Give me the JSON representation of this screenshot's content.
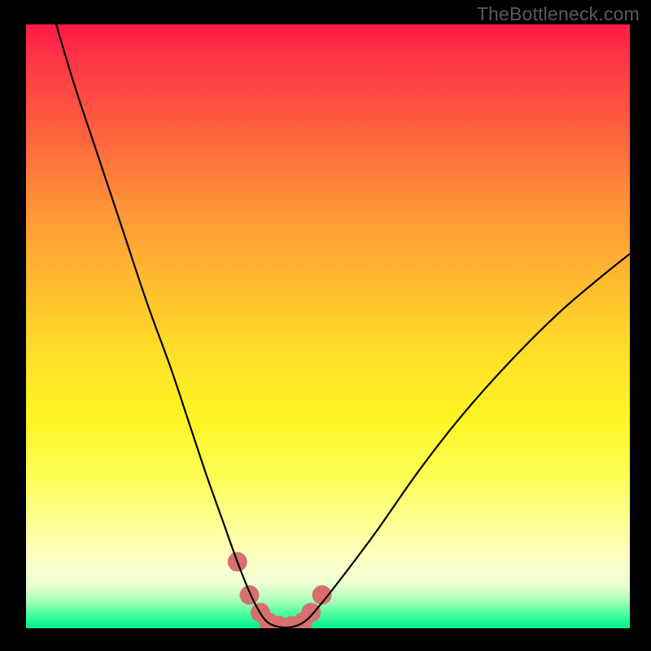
{
  "watermark": "TheBottleneck.com",
  "chart_data": {
    "type": "line",
    "title": "",
    "xlabel": "",
    "ylabel": "",
    "xlim": [
      0,
      100
    ],
    "ylim": [
      0,
      100
    ],
    "background_gradient": {
      "stops": [
        {
          "pos": 0.0,
          "color": "#ff1b48"
        },
        {
          "pos": 0.05,
          "color": "#ff3246"
        },
        {
          "pos": 0.2,
          "color": "#ff6a3d"
        },
        {
          "pos": 0.32,
          "color": "#ff9a36"
        },
        {
          "pos": 0.45,
          "color": "#ffc22e"
        },
        {
          "pos": 0.55,
          "color": "#ffe028"
        },
        {
          "pos": 0.65,
          "color": "#fff423"
        },
        {
          "pos": 0.75,
          "color": "#feff56"
        },
        {
          "pos": 0.82,
          "color": "#feff8f"
        },
        {
          "pos": 0.87,
          "color": "#feffb8"
        },
        {
          "pos": 0.905,
          "color": "#f8ffd0"
        },
        {
          "pos": 0.93,
          "color": "#e6ffd0"
        },
        {
          "pos": 0.955,
          "color": "#a8ffb8"
        },
        {
          "pos": 0.975,
          "color": "#4effa0"
        },
        {
          "pos": 1.0,
          "color": "#00ef8e"
        }
      ]
    },
    "series": [
      {
        "name": "bottleneck-curve",
        "color": "#000000",
        "x": [
          5.0,
          8.0,
          12.0,
          16.0,
          20.0,
          24.0,
          27.0,
          30.0,
          32.5,
          35.0,
          37.0,
          38.5,
          40.0,
          42.0,
          44.0,
          46.0,
          48.0,
          52.0,
          58.0,
          65.0,
          72.0,
          80.0,
          88.0,
          95.0,
          100.0
        ],
        "y": [
          100.0,
          90.0,
          78.0,
          66.0,
          54.0,
          43.0,
          34.0,
          25.0,
          18.0,
          11.0,
          6.0,
          3.0,
          1.0,
          0.2,
          0.2,
          1.0,
          3.0,
          8.0,
          16.0,
          26.0,
          35.0,
          44.0,
          52.0,
          58.0,
          62.0
        ]
      }
    ],
    "markers": {
      "name": "bottom-markers",
      "color": "#d6706f",
      "radius": 12,
      "points": [
        {
          "x": 35.0,
          "y": 11.0
        },
        {
          "x": 37.0,
          "y": 5.5
        },
        {
          "x": 38.8,
          "y": 2.6
        },
        {
          "x": 40.2,
          "y": 1.0
        },
        {
          "x": 42.0,
          "y": 0.4
        },
        {
          "x": 44.0,
          "y": 0.4
        },
        {
          "x": 45.8,
          "y": 1.0
        },
        {
          "x": 47.2,
          "y": 2.6
        },
        {
          "x": 49.0,
          "y": 5.5
        }
      ]
    }
  }
}
